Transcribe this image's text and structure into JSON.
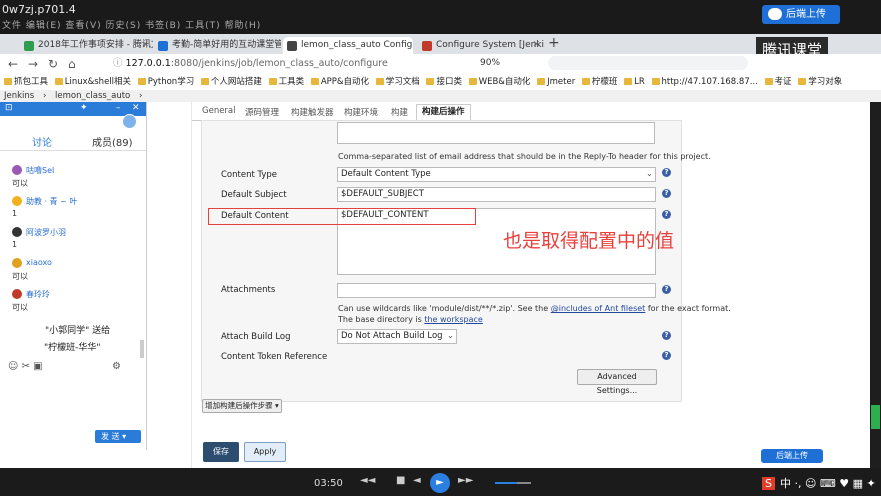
{
  "window_title": "0w7zj.p701.4",
  "menu_ghost": "文件  编辑(E)  查看(V)  历史(S)  书签(B)  工具(T)  帮助(H)",
  "tencent_upload_label": "后端上传",
  "tencent_logo": "腾讯课堂",
  "tabs": [
    {
      "label": "2018年工作事项安排 - 腾讯文",
      "color": "#2e9d4f"
    },
    {
      "label": "考勤-简单好用的互动课堂管理",
      "color": "#1d6fd6"
    },
    {
      "label": "lemon_class_auto Config [Je",
      "color": "#444"
    },
    {
      "label": "Configure System [Jenkins]",
      "color": "#c0392b"
    }
  ],
  "address": {
    "host": "127.0.0.1",
    "rest": ":8080/jenkins/job/lemon_class_auto/configure",
    "zoom": "90%"
  },
  "bookmarks": [
    "抓包工具",
    "Linux&shell相关",
    "Python学习",
    "个人网站搭建",
    "工具类",
    "APP&自动化",
    "学习文档",
    "接口类",
    "WEB&自动化",
    "Jmeter",
    "柠檬班",
    "LR",
    "http://47.107.168.87...",
    "考证",
    "学习对象"
  ],
  "breadcrumb": {
    "root": "Jenkins",
    "sep": "›",
    "job": "lemon_class_auto",
    "sep2": "›"
  },
  "config_tabs": [
    "General",
    "源码管理",
    "构建触发器",
    "构建环境",
    "构建",
    "构建后操作"
  ],
  "form": {
    "reply_to_note": "Comma-separated list of email address that should be in the Reply-To header for this project.",
    "content_type_label": "Content Type",
    "content_type_value": "Default Content Type",
    "default_subject_label": "Default Subject",
    "default_subject_value": "$DEFAULT_SUBJECT",
    "default_content_label": "Default Content",
    "default_content_value": "$DEFAULT_CONTENT",
    "attachments_label": "Attachments",
    "attachments_note_1": "Can use wildcards like 'module/dist/**/*.zip'. See the",
    "attachments_link": "@includes of Ant fileset",
    "attachments_note_2": "for the exact format.",
    "attachments_note_3": "The base directory is",
    "attachments_link_2": "the workspace",
    "attach_log_label": "Attach Build Log",
    "attach_log_value": "Do Not Attach Build Log",
    "content_token_label": "Content Token Reference",
    "advanced_button": "Advanced Settings...",
    "add_step_button": "增加构建后操作步骤",
    "help_glyph": "?"
  },
  "annotation": "也是取得配置中的值",
  "buttons": {
    "save": "保存",
    "apply": "Apply"
  },
  "chat": {
    "tab_discuss": "讨论",
    "tab_members": "成员(89)",
    "messages": [
      {
        "name": "咕噜Sel",
        "body": "可以",
        "color": "#9b59b6"
      },
      {
        "name": "助教 · 青 ~ 叶",
        "body": "1",
        "color": "#f2b01e"
      },
      {
        "name": "阿波罗小羽",
        "body": "1",
        "color": "#333"
      },
      {
        "name": "xiaoxo",
        "body": "可以",
        "color": "#e0a020"
      },
      {
        "name": "春玲玲",
        "body": "可以",
        "color": "#c0392b"
      }
    ],
    "gift_line_1": "\"小郭同学\" 送给",
    "gift_line_2": "\"柠檬班-华华\"",
    "tools": "☺  ✂  ▣",
    "send": "发 送   ▾"
  },
  "player": {
    "time": "03:50",
    "controls": [
      "◄◄",
      "■",
      "◄",
      "►",
      "►►"
    ],
    "ime": "中 ·, ☺ ⌨ ♥ ▦ ✦"
  },
  "tencent_upload_bottom": "后端上传"
}
